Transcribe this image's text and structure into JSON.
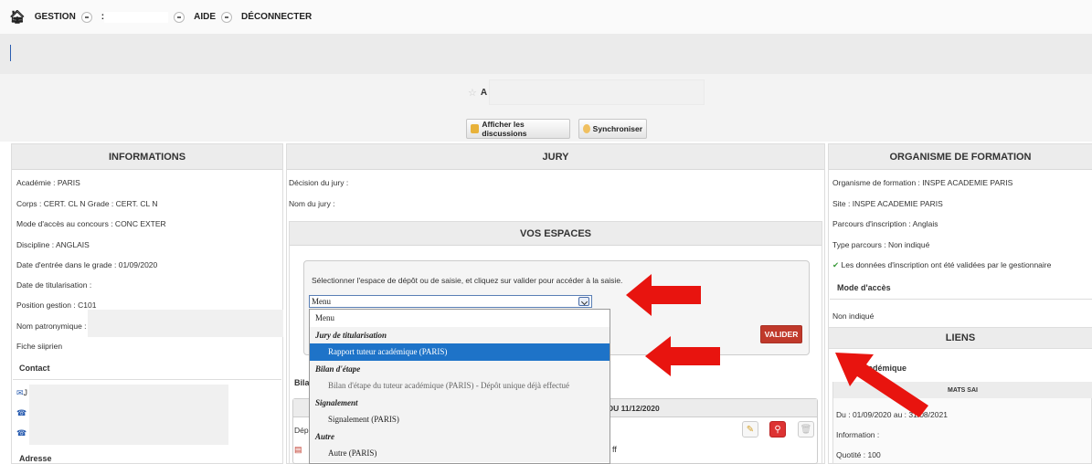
{
  "nav": {
    "items": [
      {
        "label": "GESTION",
        "dd": true
      },
      {
        "label": ":",
        "dd": true
      },
      {
        "label": "AIDE",
        "dd": true
      },
      {
        "label": "DÉCONNECTER",
        "dd": false
      }
    ]
  },
  "header": {
    "title_initial": "A"
  },
  "toolbar": {
    "discussions_label": "Afficher les discussions",
    "sync_label": "Synchroniser"
  },
  "informations": {
    "heading": "INFORMATIONS",
    "rows": [
      "Académie : PARIS",
      "Corps : CERT. CL N Grade : CERT. CL N",
      "Mode d'accès au concours : CONC EXTER",
      "Discipline : ANGLAIS",
      "Date d'entrée dans le grade : 01/09/2020",
      "Date de titularisation :",
      "Position gestion : C101",
      "Nom patronymique :",
      "Fiche siiprien"
    ],
    "contact_heading": "Contact",
    "contact_initial": "J",
    "adresse_heading": "Adresse"
  },
  "jury": {
    "heading": "JURY",
    "decision_label": "Décision du jury :",
    "nom_label": "Nom du jury :"
  },
  "espaces": {
    "heading": "VOS ESPACES",
    "instruction": "Sélectionner l'espace de dépôt ou de saisie, et cliquez sur valider pour accéder à la saisie.",
    "selected_value": "Menu",
    "valider_label": "VALIDER",
    "bilan_partial": "Bila",
    "subheading_partial": "DU 11/12/2020",
    "depot_partial": "Dép",
    "dropdown": [
      {
        "label": "Menu",
        "kind": "option"
      },
      {
        "label": "Jury de titularisation",
        "kind": "group"
      },
      {
        "label": "Rapport tuteur académique (PARIS)",
        "kind": "selected"
      },
      {
        "label": "Bilan d'étape",
        "kind": "group"
      },
      {
        "label": "Bilan d'étape du tuteur académique (PARIS) - Dépôt unique déjà effectué",
        "kind": "sub"
      },
      {
        "label": "Signalement",
        "kind": "group"
      },
      {
        "label": "Signalement (PARIS)",
        "kind": "sub"
      },
      {
        "label": "Autre",
        "kind": "group"
      },
      {
        "label": "Autre (PARIS)",
        "kind": "sub"
      }
    ]
  },
  "organisme": {
    "heading": "ORGANISME DE FORMATION",
    "rows": [
      "Organisme de formation : INSPE ACADEMIE PARIS",
      "Site : INSPE ACADEMIE PARIS",
      "Parcours d'inscription : Anglais",
      "Type parcours : Non indiqué"
    ],
    "validated_note": "Les données d'inscription ont été validées par le gestionnaire",
    "mode_heading": "Mode d'accès",
    "mode_value": "Non indiqué",
    "liens_heading": "LIENS",
    "academique_label": "académique",
    "mats_label": "MATS SAI",
    "period": "Du : 01/09/2020 au : 31/08/2021",
    "information": "Information :",
    "quotite": "Quotité : 100"
  },
  "colors": {
    "arrow": "#e8140f",
    "valider": "#c0392b",
    "selection": "#1e73c8"
  }
}
